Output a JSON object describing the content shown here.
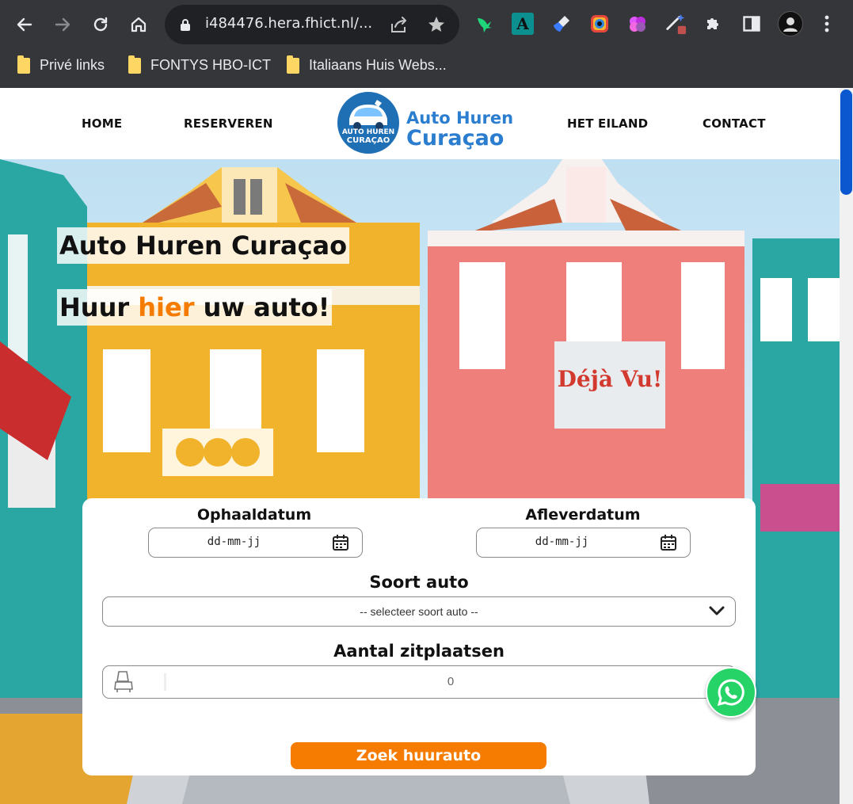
{
  "browser": {
    "url": "i484476.hera.fhict.nl/...",
    "bookmarks": [
      "Privé links",
      "FONTYS HBO-ICT",
      "Italiaans Huis Webs..."
    ]
  },
  "site": {
    "nav": {
      "home": "HOME",
      "reserve": "RESERVEREN",
      "island": "HET EILAND",
      "contact": "CONTACT"
    },
    "logo": {
      "badge_line1": "AUTO HUREN",
      "badge_line2": "CURAÇAO",
      "line1": "Auto Huren",
      "line2": "Curaçao"
    }
  },
  "hero": {
    "title": "Auto Huren Curaçao",
    "subtitle_before": "Huur ",
    "subtitle_accent": "hier",
    "subtitle_after": " uw auto!"
  },
  "form": {
    "pickup_label": "Ophaaldatum",
    "pickup_value": "dd-mm-jj",
    "dropoff_label": "Afleverdatum",
    "dropoff_value": "dd-mm-jj",
    "car_type_label": "Soort auto",
    "car_type_value": "-- selecteer soort auto --",
    "seats_label": "Aantal zitplaatsen",
    "seats_value": "0",
    "submit_label": "Zoek huurauto"
  },
  "colors": {
    "accent": "#f57c00",
    "brand_blue": "#2b7dcf",
    "whatsapp": "#25d366",
    "chrome_bg": "#35363a"
  },
  "icons": [
    "back-icon",
    "forward-icon",
    "reload-icon",
    "home-icon",
    "lock-icon",
    "share-icon",
    "star-icon",
    "puzzle-icon",
    "sidepanel-icon",
    "menu-icon",
    "calendar-icon",
    "chevron-down-icon",
    "car-seat-icon",
    "whatsapp-icon"
  ]
}
